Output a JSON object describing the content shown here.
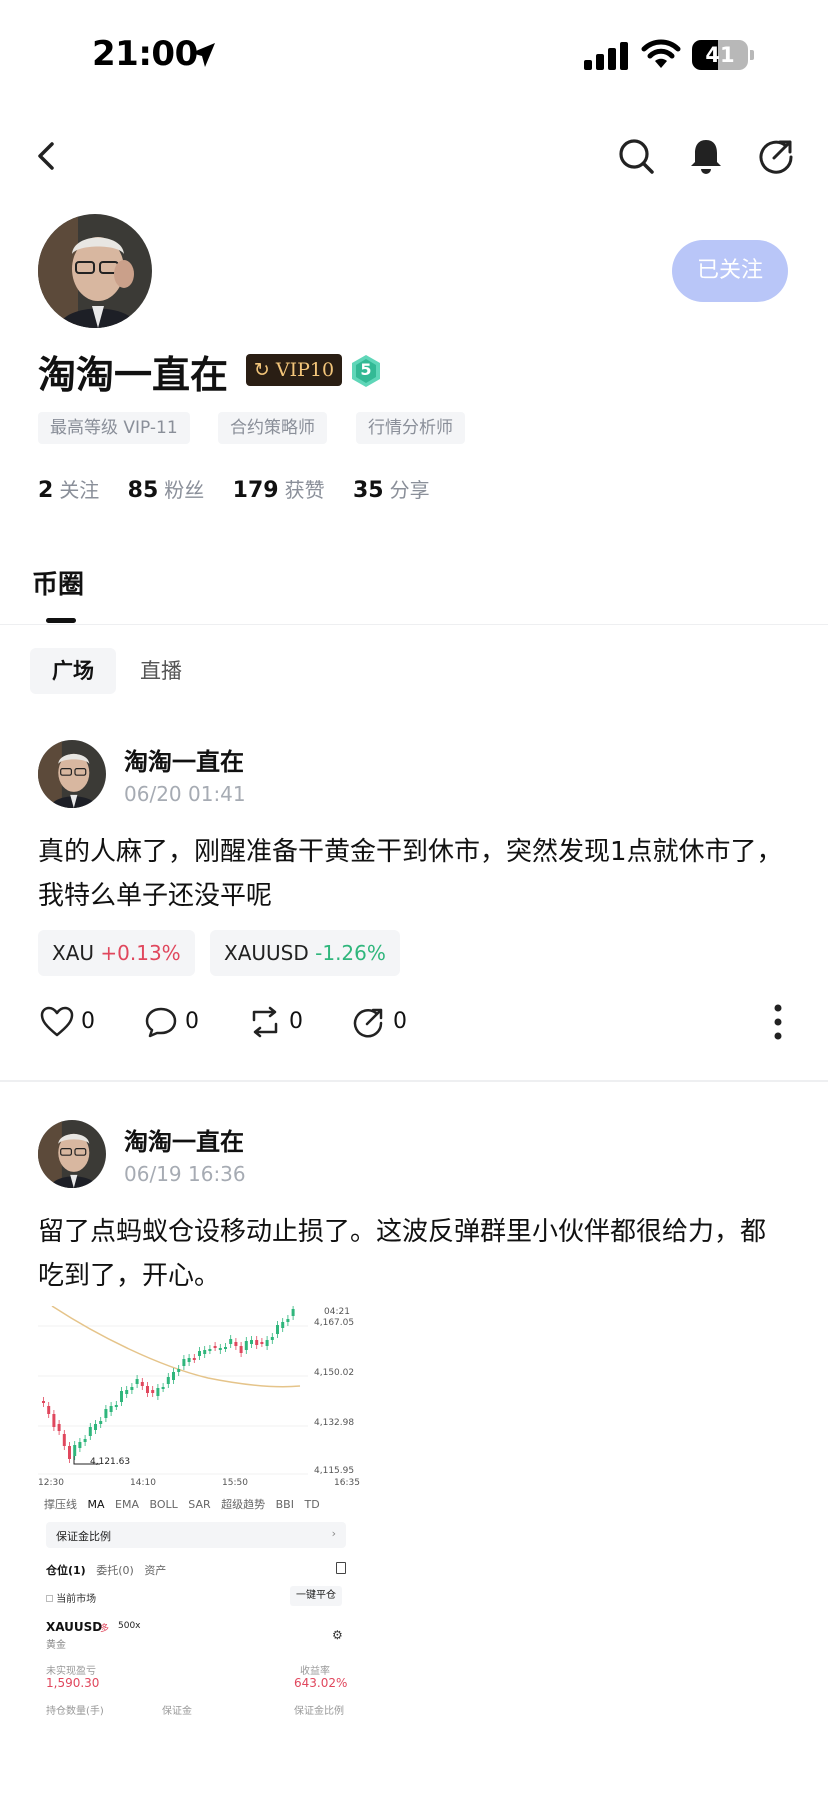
{
  "status": {
    "time": "21:00",
    "battery": "41"
  },
  "profile": {
    "name": "淘淘一直在",
    "vip": "VIP10",
    "level": "5",
    "follow_label": "已关注",
    "tags": [
      "最高等级 VIP-11",
      "合约策略师",
      "行情分析师"
    ],
    "stats": [
      {
        "num": "2",
        "label": "关注"
      },
      {
        "num": "85",
        "label": "粉丝"
      },
      {
        "num": "179",
        "label": "获赞"
      },
      {
        "num": "35",
        "label": "分享"
      }
    ]
  },
  "section": {
    "title": "币圈"
  },
  "subtabs": [
    "广场",
    "直播"
  ],
  "posts": [
    {
      "author": "淘淘一直在",
      "time": "06/20 01:41",
      "body": "真的人麻了，刚醒准备干黄金干到休市，突然发现1点就休市了，我特么单子还没平呢",
      "tickers": [
        {
          "symbol": "XAU",
          "change": "+0.13%"
        },
        {
          "symbol": "XAUUSD",
          "change": "-1.26%"
        }
      ],
      "likes": "0",
      "comments": "0",
      "reposts": "0",
      "shares": "0"
    },
    {
      "author": "淘淘一直在",
      "time": "06/19 16:36",
      "body": "留了点蚂蚁仓设移动止损了。这波反弹群里小伙伴都很给力，都吃到了，开心。"
    }
  ],
  "chart_image": {
    "y_ticks": [
      "4,167.05",
      "4,150.02",
      "4,132.98",
      "4,115.95"
    ],
    "top_tick": "04:21",
    "x_ticks": [
      "12:30",
      "14:10",
      "15:50",
      "16:35"
    ],
    "low_label": "4,121.63",
    "indicators": [
      "撑压线",
      "MA",
      "EMA",
      "BOLL",
      "SAR",
      "超级趋势",
      "BBI",
      "TD"
    ],
    "margin_label": "保证金比例",
    "tabs": [
      "仓位(1)",
      "委托(0)",
      "资产"
    ],
    "current_market": "当前市场",
    "close_all": "一键平仓",
    "symbol": "XAUUSD",
    "side": "多",
    "leverage": "500x",
    "asset_name": "黄金",
    "pnl_label": "未实现盈亏",
    "pnl_value": "1,590.30",
    "roi_label": "收益率",
    "roi_value": "643.02%",
    "bottom_labels": [
      "持仓数量(手)",
      "保证金",
      "保证金比例"
    ]
  }
}
